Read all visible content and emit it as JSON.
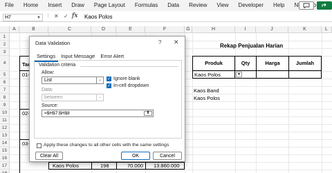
{
  "ribbon": {
    "tabs": [
      "File",
      "Home",
      "Insert",
      "Draw",
      "Page Layout",
      "Formulas",
      "Data",
      "Review",
      "View",
      "Developer",
      "Help",
      "Nitro Pro"
    ]
  },
  "formula_bar": {
    "name_box": "H7",
    "fx": "fx",
    "content": "Kaos Polos"
  },
  "grid": {
    "columns": [
      "A",
      "B",
      "C",
      "D",
      "E",
      "F",
      "G",
      "H",
      "I",
      "J",
      "K",
      "L"
    ],
    "rows": [
      "1",
      "2",
      "3",
      "4",
      "5",
      "6",
      "7",
      "8",
      "9",
      "10",
      "11",
      "12",
      "13",
      "14",
      "15",
      "16",
      "17",
      "18"
    ],
    "left_fragments": {
      "header_fragment": "Tar",
      "date1": "01-1",
      "date2": "02-1",
      "date3": "03-1"
    },
    "bottom_row": {
      "product": "Kaos Polos",
      "qty": "198",
      "price": "70.000",
      "total": "13.860.000"
    }
  },
  "recap": {
    "title": "Rekap Penjualan Harian",
    "headers": [
      "Produk",
      "Qty",
      "Harga",
      "Jumlah"
    ],
    "selected_value": "Kaos Polos",
    "list_items": [
      "Kaos Band",
      "Kaos Polos"
    ]
  },
  "dialog": {
    "title": "Data Validation",
    "help": "?",
    "close": "✕",
    "tabs": [
      "Settings",
      "Input Message",
      "Error Alert"
    ],
    "criteria_label": "Validation criteria",
    "allow_label": "Allow:",
    "allow_value": "List",
    "data_label": "Data:",
    "data_value": "between",
    "ignore_blank": "Ignore blank",
    "in_cell_dropdown": "In-cell dropdown",
    "source_label": "Source:",
    "source_value": "=$H$7:$H$8",
    "apply_all": "Apply these changes to all other cells with the same settings",
    "clear_all": "Clear All",
    "ok": "OK",
    "cancel": "Cancel"
  }
}
